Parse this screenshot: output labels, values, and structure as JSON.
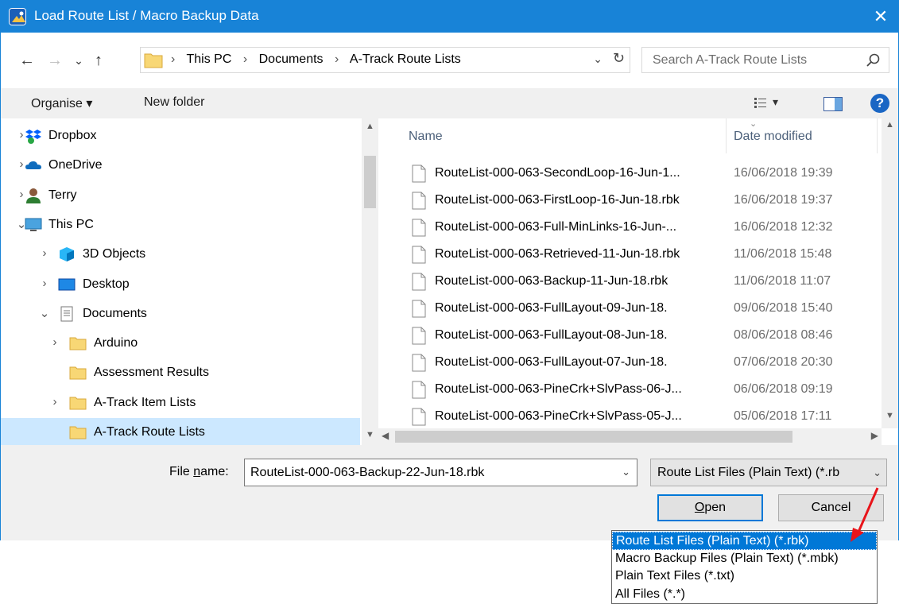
{
  "window": {
    "title": "Load Route List / Macro Backup Data",
    "close_glyph": "✕",
    "app_icon": "a-track-app-icon"
  },
  "nav": {
    "back_glyph": "←",
    "forward_glyph": "→",
    "recent_glyph": "⌄",
    "up_glyph": "↑"
  },
  "address": {
    "crumbs": [
      "This PC",
      "Documents",
      "A-Track Route Lists"
    ],
    "separator": "›",
    "dropdown_glyph": "⌄",
    "refresh_glyph": "↻"
  },
  "search": {
    "placeholder": "Search A-Track Route Lists"
  },
  "toolbar": {
    "organise_label": "Organise ▾",
    "new_folder_label": "New folder",
    "view_dropdown_glyph": "▾",
    "help_glyph": "?"
  },
  "sidebar": {
    "items": [
      {
        "label": "Dropbox",
        "icon": "dropbox-icon",
        "expander": "›",
        "level": 0
      },
      {
        "label": "OneDrive",
        "icon": "onedrive-icon",
        "expander": "›",
        "level": 0
      },
      {
        "label": "Terry",
        "icon": "user-icon",
        "expander": "›",
        "level": 0
      },
      {
        "label": "This PC",
        "icon": "pc-icon",
        "expander": "⌄",
        "level": 0
      },
      {
        "label": "3D Objects",
        "icon": "3d-objects-icon",
        "expander": "›",
        "level": 1
      },
      {
        "label": "Desktop",
        "icon": "desktop-icon",
        "expander": "›",
        "level": 1
      },
      {
        "label": "Documents",
        "icon": "documents-icon",
        "expander": "⌄",
        "level": 1
      },
      {
        "label": "Arduino",
        "icon": "folder-icon",
        "expander": "›",
        "level": 2
      },
      {
        "label": "Assessment Results",
        "icon": "folder-icon",
        "expander": "",
        "level": 2
      },
      {
        "label": "A-Track Item Lists",
        "icon": "folder-icon",
        "expander": "›",
        "level": 2
      },
      {
        "label": "A-Track Route Lists",
        "icon": "folder-icon",
        "expander": "",
        "level": 2,
        "selected": true
      }
    ]
  },
  "files": {
    "columns": {
      "name": "Name",
      "date": "Date modified"
    },
    "rows": [
      {
        "name": "RouteList-000-063-SecondLoop-16-Jun-1...",
        "date": "16/06/2018 19:39"
      },
      {
        "name": "RouteList-000-063-FirstLoop-16-Jun-18.rbk",
        "date": "16/06/2018 19:37"
      },
      {
        "name": "RouteList-000-063-Full-MinLinks-16-Jun-...",
        "date": "16/06/2018 12:32"
      },
      {
        "name": "RouteList-000-063-Retrieved-11-Jun-18.rbk",
        "date": "11/06/2018 15:48"
      },
      {
        "name": "RouteList-000-063-Backup-11-Jun-18.rbk",
        "date": "11/06/2018 11:07"
      },
      {
        "name": "RouteList-000-063-FullLayout-09-Jun-18.",
        "date": "09/06/2018 15:40"
      },
      {
        "name": "RouteList-000-063-FullLayout-08-Jun-18.",
        "date": "08/06/2018 08:46"
      },
      {
        "name": "RouteList-000-063-FullLayout-07-Jun-18.",
        "date": "07/06/2018 20:30"
      },
      {
        "name": "RouteList-000-063-PineCrk+SlvPass-06-J...",
        "date": "06/06/2018 09:19"
      },
      {
        "name": "RouteList-000-063-PineCrk+SlvPass-05-J...",
        "date": "05/06/2018 17:11"
      }
    ]
  },
  "footer": {
    "file_name_label_prefix": "File ",
    "file_name_label_accel": "n",
    "file_name_label_suffix": "ame:",
    "file_name_value": "RouteList-000-063-Backup-22-Jun-18.rbk",
    "filter_value": "Route List Files (Plain Text) (*.rb",
    "dropdown_glyph": "⌄",
    "open_accel": "O",
    "open_rest": "pen",
    "cancel_label": "Cancel"
  },
  "filter_options": [
    {
      "label": "Route List Files (Plain Text) (*.rbk)",
      "selected": true
    },
    {
      "label": "Macro Backup Files (Plain Text) (*.mbk)"
    },
    {
      "label": "Plain Text Files (*.txt)"
    },
    {
      "label": "All Files (*.*)"
    }
  ],
  "colors": {
    "titlebar": "#1883d7",
    "selection": "#cce8ff",
    "highlight": "#0078d7",
    "annotation_arrow": "#e8141a"
  }
}
